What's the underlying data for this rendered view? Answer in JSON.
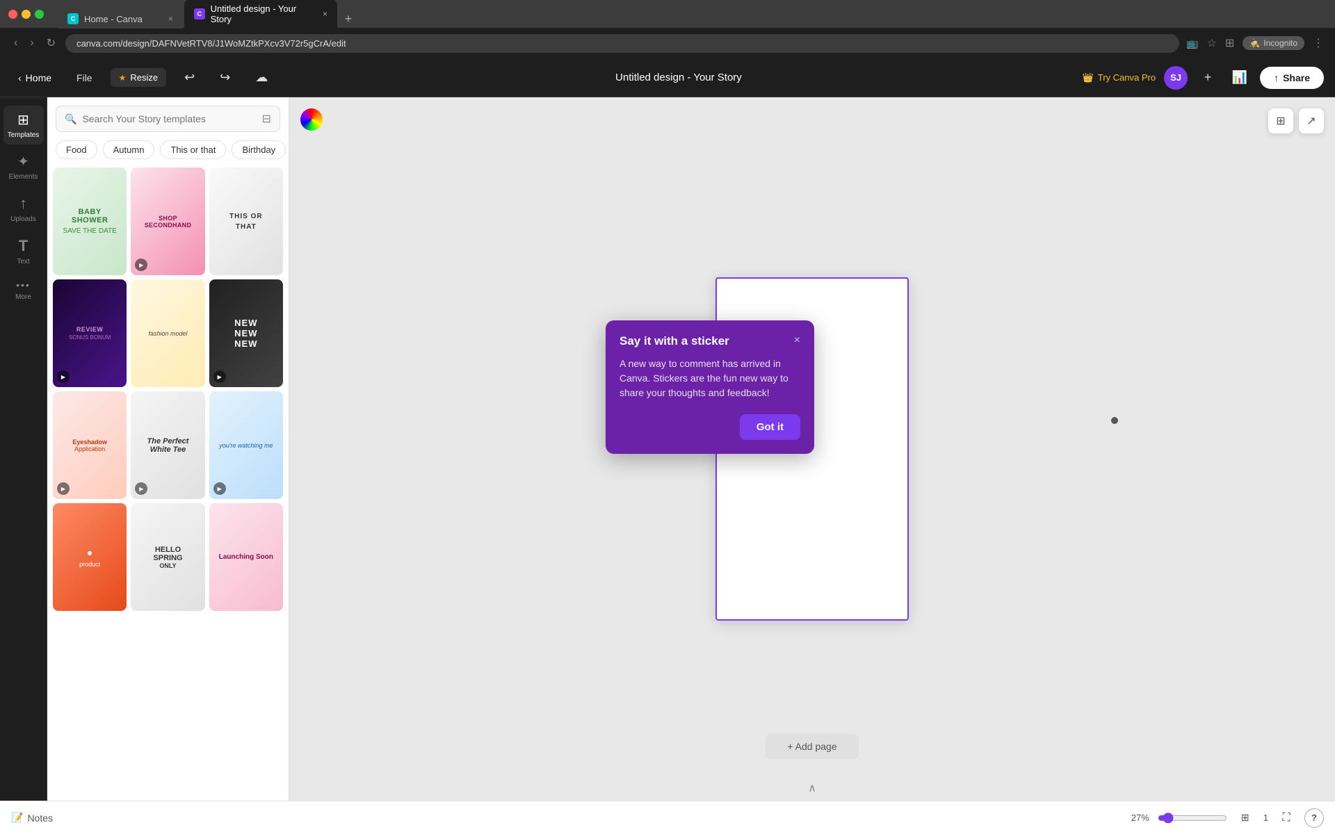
{
  "browser": {
    "tabs": [
      {
        "id": "tab-home",
        "label": "Home - Canva",
        "favicon": "C",
        "active": false
      },
      {
        "id": "tab-design",
        "label": "Untitled design - Your Story",
        "favicon": "C",
        "active": true
      }
    ],
    "address": "canva.com/design/DAFNVetRTV8/J1WoMZtkPXcv3V72r5gCrA/edit",
    "incognito_label": "Incognito"
  },
  "topbar": {
    "home_label": "Home",
    "file_label": "File",
    "resize_label": "Resize",
    "design_title": "Untitled design - Your Story",
    "try_pro_label": "Try Canva Pro",
    "share_label": "Share",
    "avatar_initials": "SJ"
  },
  "sidebar": {
    "items": [
      {
        "id": "templates",
        "label": "Templates",
        "icon": "⊞",
        "active": true
      },
      {
        "id": "elements",
        "label": "Elements",
        "icon": "✦"
      },
      {
        "id": "uploads",
        "label": "Uploads",
        "icon": "↑"
      },
      {
        "id": "text",
        "label": "Text",
        "icon": "T"
      },
      {
        "id": "more",
        "label": "More",
        "icon": "···"
      }
    ]
  },
  "templates_panel": {
    "search_placeholder": "Search Your Story templates",
    "tags": [
      "Food",
      "Autumn",
      "This or that",
      "Birthday"
    ],
    "more_arrow": "›"
  },
  "canvas": {
    "add_page_label": "+ Add page",
    "refresh_icon": "↻",
    "copy_icon": "⊞",
    "share_icon": "↗"
  },
  "popup": {
    "title": "Say it with a sticker",
    "body": "A new way to comment has arrived in Canva. Stickers are the fun new way to share your thoughts and feedback!",
    "close_icon": "×",
    "button_label": "Got it"
  },
  "bottom_bar": {
    "notes_label": "Notes",
    "zoom_percent": "27%",
    "page_number": "1",
    "help_label": "?"
  },
  "colors": {
    "accent": "#7c3aed",
    "popup_bg": "#6b21a8",
    "popup_btn": "#7c3aed"
  }
}
